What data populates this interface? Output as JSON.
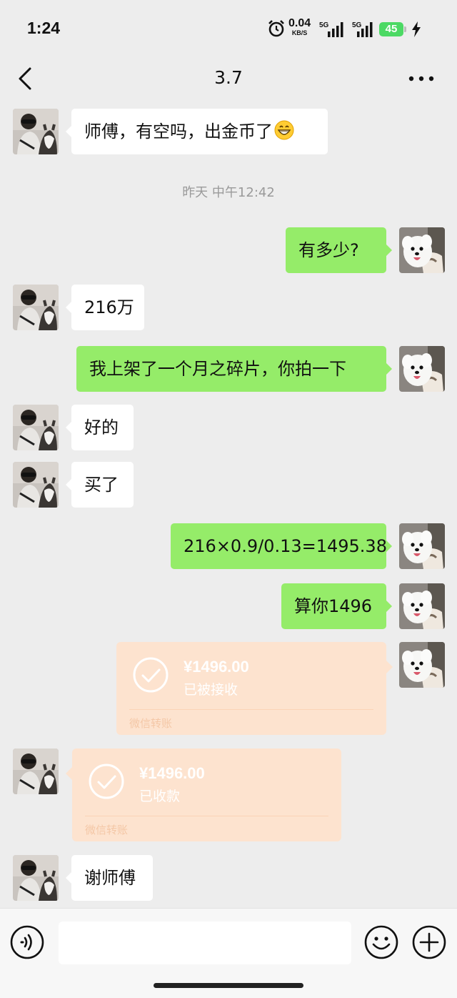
{
  "status_bar": {
    "time": "1:24",
    "net_speed_value": "0.04",
    "net_speed_unit": "KB/S",
    "signal1_label": "5G",
    "signal2_label": "5G",
    "battery_level": "45"
  },
  "header": {
    "title": "3.7"
  },
  "timestamp": "昨天 中午12:42",
  "messages": [
    {
      "from": "contact",
      "text": "师傅，有空吗，出金币了",
      "emoji": "grinning-face-emoji"
    },
    {
      "from": "me",
      "text": "有多少?"
    },
    {
      "from": "contact",
      "text": "216万"
    },
    {
      "from": "me",
      "text": "我上架了一个月之碎片，你拍一下"
    },
    {
      "from": "contact",
      "text": "好的"
    },
    {
      "from": "contact",
      "text": "买了"
    },
    {
      "from": "me",
      "text": "216×0.9/0.13=1495.38"
    },
    {
      "from": "me",
      "text": "算你1496"
    },
    {
      "from": "me",
      "type": "transfer",
      "amount": "¥1496.00",
      "status": "已被接收",
      "footer": "微信转账"
    },
    {
      "from": "contact",
      "type": "transfer",
      "amount": "¥1496.00",
      "status": "已收款",
      "footer": "微信转账"
    },
    {
      "from": "contact",
      "text": "谢师傅"
    }
  ],
  "input_bar": {
    "placeholder": ""
  },
  "colors": {
    "background": "#ededed",
    "outgoing_bubble": "#95ec69",
    "incoming_bubble": "#ffffff",
    "transfer_card": "#fde3cf",
    "battery": "#4cd964"
  }
}
